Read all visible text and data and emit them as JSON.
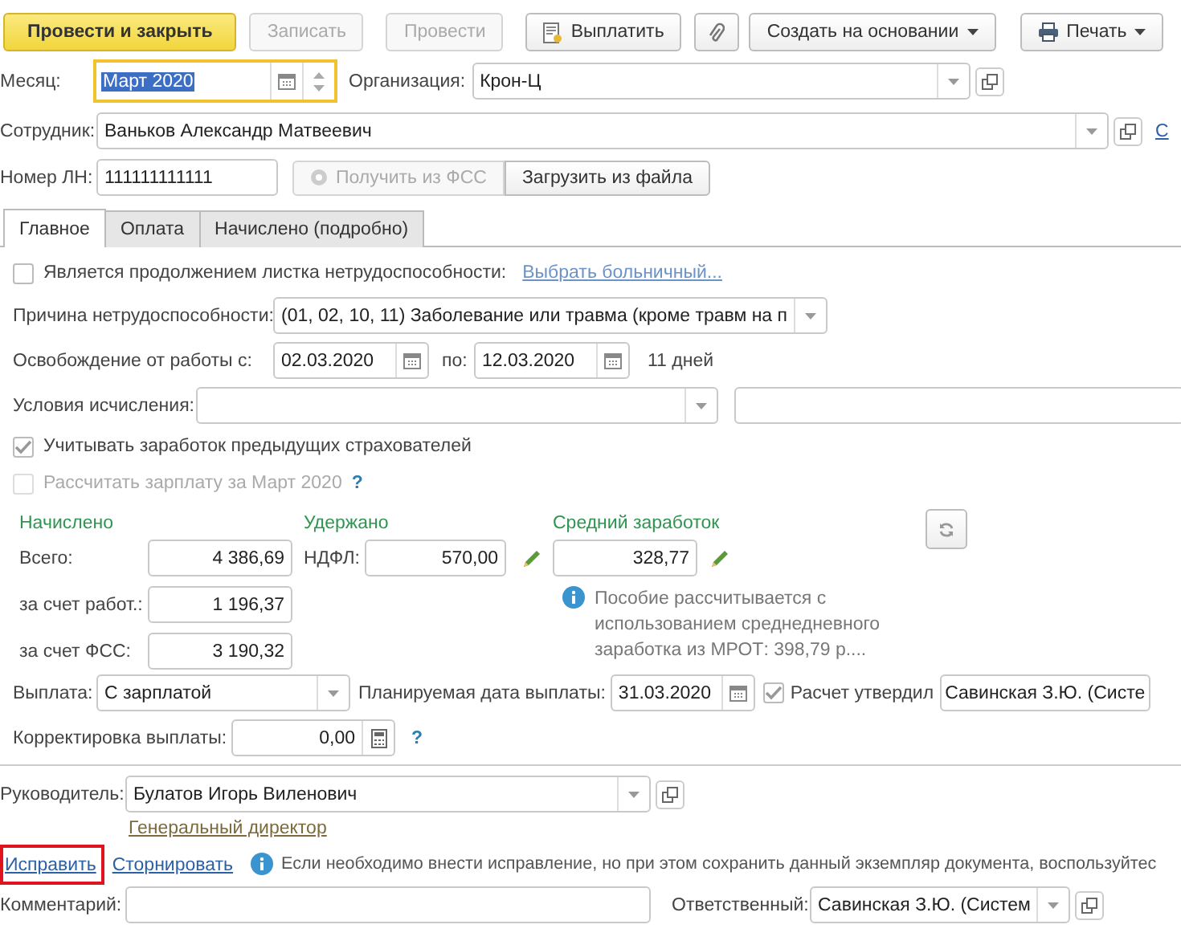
{
  "toolbar": [
    {
      "label": "Провести и закрыть",
      "kind": "primary",
      "disabled": false
    },
    {
      "label": "Записать",
      "kind": "plain",
      "disabled": true
    },
    {
      "label": "Провести",
      "kind": "plain",
      "disabled": true
    },
    {
      "label": "Выплатить",
      "kind": "document",
      "disabled": false
    },
    {
      "kind": "attach",
      "disabled": false
    },
    {
      "label": "Создать на основании",
      "kind": "dropdown",
      "disabled": false
    },
    {
      "label": "Печать",
      "kind": "print",
      "disabled": false
    }
  ],
  "header": {
    "month": {
      "label": "Месяц:",
      "value": "Март 2020",
      "focused": true
    },
    "organization": {
      "label": "Организация:",
      "value": "Крон-Ц"
    },
    "employee": {
      "label": "Сотрудник:",
      "value": "Ваньков Александр Матвеевич",
      "edge_link": "С"
    },
    "sick_note": {
      "label": "Номер ЛН:",
      "value": "111111111111",
      "buttons": [
        {
          "label": "Получить из ФСС",
          "disabled": true
        },
        {
          "label": "Загрузить из файла",
          "disabled": false
        }
      ]
    }
  },
  "tabs": [
    {
      "label": "Главное",
      "selected": true
    },
    {
      "label": "Оплата",
      "selected": false
    },
    {
      "label": "Начислено (подробно)",
      "selected": false
    }
  ],
  "main": {
    "continuation": {
      "label": "Является продолжением листка нетрудоспособности:",
      "checked": false,
      "link": "Выбрать больничный..."
    },
    "reason": {
      "label": "Причина нетрудоспособности:",
      "value": "(01, 02, 10, 11) Заболевание или травма (кроме травм на п"
    },
    "release": {
      "label": "Освобождение от работы с:",
      "from": "02.03.2020",
      "to_label": "по:",
      "to": "12.03.2020",
      "days": "11 дней"
    },
    "conditions": {
      "label": "Условия исчисления:"
    },
    "checkboxes": [
      {
        "label": "Учитывать заработок предыдущих страхователей",
        "checked": true,
        "disabled": false
      },
      {
        "label": "Рассчитать зарплату за Март 2020",
        "checked": false,
        "disabled": true,
        "help": "?"
      }
    ],
    "accrued": {
      "title": "Начислено",
      "rows": [
        {
          "label": "Всего:",
          "value": "4 386,69"
        },
        {
          "label": "за счет работ.:",
          "value": "1 196,37"
        },
        {
          "label": "за счет ФСС:",
          "value": "3 190,32"
        }
      ]
    },
    "withheld": {
      "title": "Удержано",
      "label": "НДФЛ:",
      "value": "570,00"
    },
    "average": {
      "title": "Средний заработок",
      "value": "328,77",
      "note": "Пособие рассчитывается с использованием среднедневного заработка из МРОТ: 398,79 р...."
    },
    "payment": {
      "label": "Выплата:",
      "value": "С зарплатой",
      "date_label": "Планируемая дата выплаты:",
      "date": "31.03.2020",
      "approved_label": "Расчет утвердил",
      "approved": true,
      "approver": "Савинская З.Ю. (Систе"
    },
    "correction": {
      "label": "Корректировка выплаты:",
      "value": "0,00",
      "help": "?"
    }
  },
  "footer": {
    "head": {
      "label": "Руководитель:",
      "value": "Булатов Игорь Виленович",
      "position": "Генеральный директор"
    },
    "actions": [
      {
        "label": "Исправить",
        "highlighted": true
      },
      {
        "label": "Сторнировать",
        "highlighted": false
      }
    ],
    "note": "Если необходимо внести исправление, но при этом сохранить данный экземпляр документа, воспользуйтес",
    "comment": {
      "label": "Комментарий:"
    },
    "responsible": {
      "label": "Ответственный:",
      "value": "Савинская З.Ю. (Систем"
    }
  }
}
